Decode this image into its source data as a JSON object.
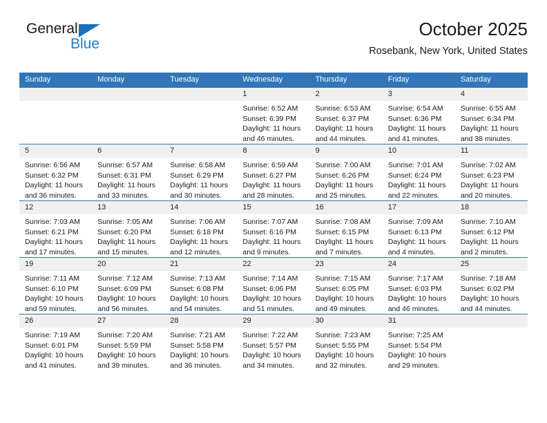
{
  "logo": {
    "word1": "General",
    "word2": "Blue",
    "triangle_color": "#1d6fb8",
    "word2_color": "#1d7ec4"
  },
  "header": {
    "title": "October 2025",
    "subtitle": "Rosebank, New York, United States"
  },
  "theme": {
    "header_blue": "#3076b8",
    "daynum_band": "#f0f0f0",
    "text": "#1a1a1a"
  },
  "weekday_headers": [
    "Sunday",
    "Monday",
    "Tuesday",
    "Wednesday",
    "Thursday",
    "Friday",
    "Saturday"
  ],
  "labels": {
    "sunrise_prefix": "Sunrise:",
    "sunset_prefix": "Sunset:",
    "daylight_prefix": "Daylight:"
  },
  "weeks": [
    [
      {
        "day": "",
        "empty": true,
        "sunrise": "",
        "sunset": "",
        "daylight_1": "",
        "daylight_2": ""
      },
      {
        "day": "",
        "empty": true,
        "sunrise": "",
        "sunset": "",
        "daylight_1": "",
        "daylight_2": ""
      },
      {
        "day": "",
        "empty": true,
        "sunrise": "",
        "sunset": "",
        "daylight_1": "",
        "daylight_2": ""
      },
      {
        "day": "1",
        "empty": false,
        "sunrise": "Sunrise: 6:52 AM",
        "sunset": "Sunset: 6:39 PM",
        "daylight_1": "Daylight: 11 hours",
        "daylight_2": "and 46 minutes."
      },
      {
        "day": "2",
        "empty": false,
        "sunrise": "Sunrise: 6:53 AM",
        "sunset": "Sunset: 6:37 PM",
        "daylight_1": "Daylight: 11 hours",
        "daylight_2": "and 44 minutes."
      },
      {
        "day": "3",
        "empty": false,
        "sunrise": "Sunrise: 6:54 AM",
        "sunset": "Sunset: 6:36 PM",
        "daylight_1": "Daylight: 11 hours",
        "daylight_2": "and 41 minutes."
      },
      {
        "day": "4",
        "empty": false,
        "sunrise": "Sunrise: 6:55 AM",
        "sunset": "Sunset: 6:34 PM",
        "daylight_1": "Daylight: 11 hours",
        "daylight_2": "and 38 minutes."
      }
    ],
    [
      {
        "day": "5",
        "empty": false,
        "sunrise": "Sunrise: 6:56 AM",
        "sunset": "Sunset: 6:32 PM",
        "daylight_1": "Daylight: 11 hours",
        "daylight_2": "and 36 minutes."
      },
      {
        "day": "6",
        "empty": false,
        "sunrise": "Sunrise: 6:57 AM",
        "sunset": "Sunset: 6:31 PM",
        "daylight_1": "Daylight: 11 hours",
        "daylight_2": "and 33 minutes."
      },
      {
        "day": "7",
        "empty": false,
        "sunrise": "Sunrise: 6:58 AM",
        "sunset": "Sunset: 6:29 PM",
        "daylight_1": "Daylight: 11 hours",
        "daylight_2": "and 30 minutes."
      },
      {
        "day": "8",
        "empty": false,
        "sunrise": "Sunrise: 6:59 AM",
        "sunset": "Sunset: 6:27 PM",
        "daylight_1": "Daylight: 11 hours",
        "daylight_2": "and 28 minutes."
      },
      {
        "day": "9",
        "empty": false,
        "sunrise": "Sunrise: 7:00 AM",
        "sunset": "Sunset: 6:26 PM",
        "daylight_1": "Daylight: 11 hours",
        "daylight_2": "and 25 minutes."
      },
      {
        "day": "10",
        "empty": false,
        "sunrise": "Sunrise: 7:01 AM",
        "sunset": "Sunset: 6:24 PM",
        "daylight_1": "Daylight: 11 hours",
        "daylight_2": "and 22 minutes."
      },
      {
        "day": "11",
        "empty": false,
        "sunrise": "Sunrise: 7:02 AM",
        "sunset": "Sunset: 6:23 PM",
        "daylight_1": "Daylight: 11 hours",
        "daylight_2": "and 20 minutes."
      }
    ],
    [
      {
        "day": "12",
        "empty": false,
        "sunrise": "Sunrise: 7:03 AM",
        "sunset": "Sunset: 6:21 PM",
        "daylight_1": "Daylight: 11 hours",
        "daylight_2": "and 17 minutes."
      },
      {
        "day": "13",
        "empty": false,
        "sunrise": "Sunrise: 7:05 AM",
        "sunset": "Sunset: 6:20 PM",
        "daylight_1": "Daylight: 11 hours",
        "daylight_2": "and 15 minutes."
      },
      {
        "day": "14",
        "empty": false,
        "sunrise": "Sunrise: 7:06 AM",
        "sunset": "Sunset: 6:18 PM",
        "daylight_1": "Daylight: 11 hours",
        "daylight_2": "and 12 minutes."
      },
      {
        "day": "15",
        "empty": false,
        "sunrise": "Sunrise: 7:07 AM",
        "sunset": "Sunset: 6:16 PM",
        "daylight_1": "Daylight: 11 hours",
        "daylight_2": "and 9 minutes."
      },
      {
        "day": "16",
        "empty": false,
        "sunrise": "Sunrise: 7:08 AM",
        "sunset": "Sunset: 6:15 PM",
        "daylight_1": "Daylight: 11 hours",
        "daylight_2": "and 7 minutes."
      },
      {
        "day": "17",
        "empty": false,
        "sunrise": "Sunrise: 7:09 AM",
        "sunset": "Sunset: 6:13 PM",
        "daylight_1": "Daylight: 11 hours",
        "daylight_2": "and 4 minutes."
      },
      {
        "day": "18",
        "empty": false,
        "sunrise": "Sunrise: 7:10 AM",
        "sunset": "Sunset: 6:12 PM",
        "daylight_1": "Daylight: 11 hours",
        "daylight_2": "and 2 minutes."
      }
    ],
    [
      {
        "day": "19",
        "empty": false,
        "sunrise": "Sunrise: 7:11 AM",
        "sunset": "Sunset: 6:10 PM",
        "daylight_1": "Daylight: 10 hours",
        "daylight_2": "and 59 minutes."
      },
      {
        "day": "20",
        "empty": false,
        "sunrise": "Sunrise: 7:12 AM",
        "sunset": "Sunset: 6:09 PM",
        "daylight_1": "Daylight: 10 hours",
        "daylight_2": "and 56 minutes."
      },
      {
        "day": "21",
        "empty": false,
        "sunrise": "Sunrise: 7:13 AM",
        "sunset": "Sunset: 6:08 PM",
        "daylight_1": "Daylight: 10 hours",
        "daylight_2": "and 54 minutes."
      },
      {
        "day": "22",
        "empty": false,
        "sunrise": "Sunrise: 7:14 AM",
        "sunset": "Sunset: 6:06 PM",
        "daylight_1": "Daylight: 10 hours",
        "daylight_2": "and 51 minutes."
      },
      {
        "day": "23",
        "empty": false,
        "sunrise": "Sunrise: 7:15 AM",
        "sunset": "Sunset: 6:05 PM",
        "daylight_1": "Daylight: 10 hours",
        "daylight_2": "and 49 minutes."
      },
      {
        "day": "24",
        "empty": false,
        "sunrise": "Sunrise: 7:17 AM",
        "sunset": "Sunset: 6:03 PM",
        "daylight_1": "Daylight: 10 hours",
        "daylight_2": "and 46 minutes."
      },
      {
        "day": "25",
        "empty": false,
        "sunrise": "Sunrise: 7:18 AM",
        "sunset": "Sunset: 6:02 PM",
        "daylight_1": "Daylight: 10 hours",
        "daylight_2": "and 44 minutes."
      }
    ],
    [
      {
        "day": "26",
        "empty": false,
        "sunrise": "Sunrise: 7:19 AM",
        "sunset": "Sunset: 6:01 PM",
        "daylight_1": "Daylight: 10 hours",
        "daylight_2": "and 41 minutes."
      },
      {
        "day": "27",
        "empty": false,
        "sunrise": "Sunrise: 7:20 AM",
        "sunset": "Sunset: 5:59 PM",
        "daylight_1": "Daylight: 10 hours",
        "daylight_2": "and 39 minutes."
      },
      {
        "day": "28",
        "empty": false,
        "sunrise": "Sunrise: 7:21 AM",
        "sunset": "Sunset: 5:58 PM",
        "daylight_1": "Daylight: 10 hours",
        "daylight_2": "and 36 minutes."
      },
      {
        "day": "29",
        "empty": false,
        "sunrise": "Sunrise: 7:22 AM",
        "sunset": "Sunset: 5:57 PM",
        "daylight_1": "Daylight: 10 hours",
        "daylight_2": "and 34 minutes."
      },
      {
        "day": "30",
        "empty": false,
        "sunrise": "Sunrise: 7:23 AM",
        "sunset": "Sunset: 5:55 PM",
        "daylight_1": "Daylight: 10 hours",
        "daylight_2": "and 32 minutes."
      },
      {
        "day": "31",
        "empty": false,
        "sunrise": "Sunrise: 7:25 AM",
        "sunset": "Sunset: 5:54 PM",
        "daylight_1": "Daylight: 10 hours",
        "daylight_2": "and 29 minutes."
      },
      {
        "day": "",
        "empty": true,
        "sunrise": "",
        "sunset": "",
        "daylight_1": "",
        "daylight_2": ""
      }
    ]
  ]
}
